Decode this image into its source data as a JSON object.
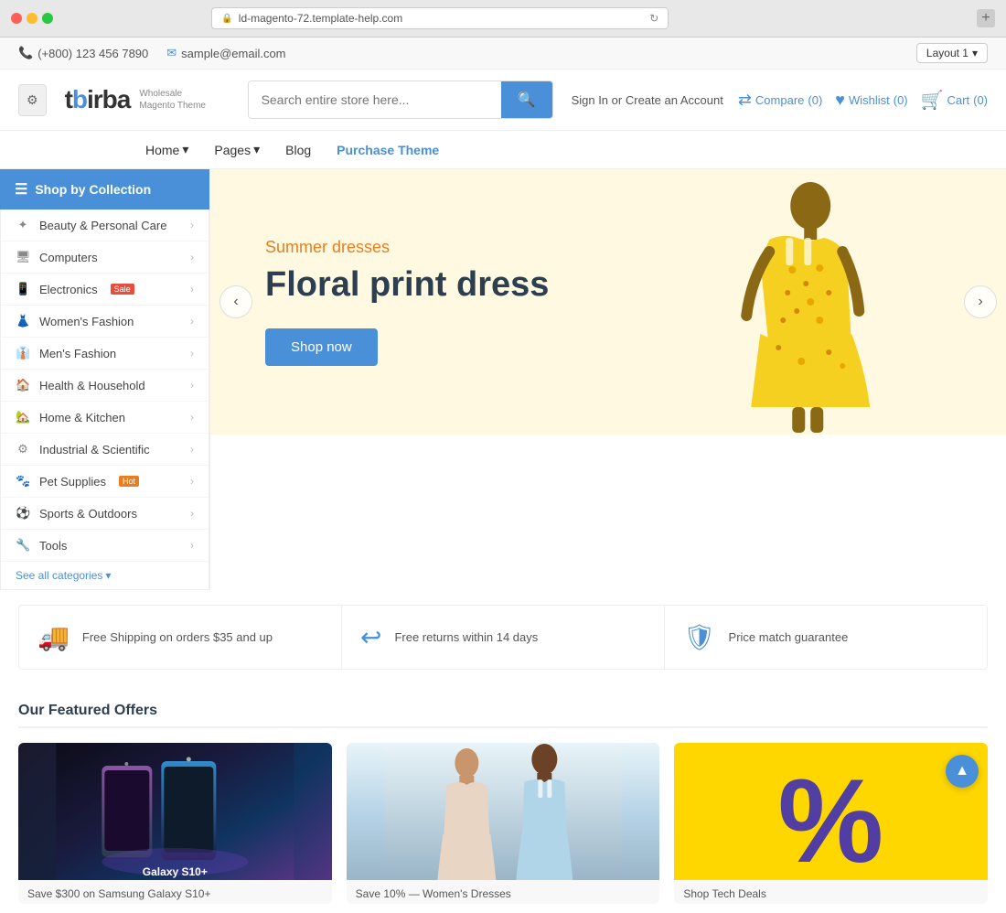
{
  "browser": {
    "url": "ld-magento-72.template-help.com",
    "new_tab_label": "+"
  },
  "topbar": {
    "phone": "(+800) 123 456 7890",
    "email": "sample@email.com",
    "layout_label": "Layout 1"
  },
  "header": {
    "logo_text": "tbirba",
    "logo_sub1": "Wholesale",
    "logo_sub2": "Magento Theme",
    "search_placeholder": "Search entire store here...",
    "sign_in": "Sign In",
    "or_label": "or",
    "create_account": "Create an Account",
    "compare_label": "Compare",
    "compare_count": "(0)",
    "wishlist_label": "Wishlist",
    "wishlist_count": "(0)",
    "cart_label": "Cart",
    "cart_count": "(0)"
  },
  "nav": {
    "items": [
      {
        "label": "Home",
        "has_arrow": true
      },
      {
        "label": "Pages",
        "has_arrow": true
      },
      {
        "label": "Blog",
        "has_arrow": false
      },
      {
        "label": "Purchase Theme",
        "has_arrow": false,
        "highlight": true
      }
    ]
  },
  "sidebar": {
    "collection_label": "Shop by Collection",
    "items": [
      {
        "label": "Beauty & Personal Care",
        "icon": "✦",
        "badge": null
      },
      {
        "label": "Computers",
        "icon": "🖥",
        "badge": null
      },
      {
        "label": "Electronics",
        "icon": "📱",
        "badge": "Sale"
      },
      {
        "label": "Women's Fashion",
        "icon": "👗",
        "badge": null
      },
      {
        "label": "Men's Fashion",
        "icon": "👔",
        "badge": null
      },
      {
        "label": "Health & Household",
        "icon": "🏠",
        "badge": null
      },
      {
        "label": "Home & Kitchen",
        "icon": "🏡",
        "badge": null
      },
      {
        "label": "Industrial & Scientific",
        "icon": "⚙",
        "badge": null
      },
      {
        "label": "Pet Supplies",
        "icon": "🐾",
        "badge": "Hot"
      },
      {
        "label": "Sports & Outdoors",
        "icon": "⚽",
        "badge": null
      },
      {
        "label": "Tools",
        "icon": "🔧",
        "badge": null
      }
    ],
    "see_all": "See all categories"
  },
  "hero": {
    "subtitle": "Summer dresses",
    "title": "Floral print dress",
    "btn_label": "Shop now"
  },
  "features": [
    {
      "icon": "🚚",
      "text": "Free Shipping on orders $35 and up"
    },
    {
      "icon": "↩",
      "text": "Free returns within 14 days"
    },
    {
      "icon": "🛡",
      "text": "Price match guarantee"
    }
  ],
  "featured": {
    "title": "Our Featured Offers",
    "offers": [
      {
        "label": "Save $300 on Samsung Galaxy S10+"
      },
      {
        "label": "Save 10% — Women's Dresses"
      },
      {
        "label": "Shop Tech Deals"
      }
    ]
  },
  "scroll_top": "▲"
}
